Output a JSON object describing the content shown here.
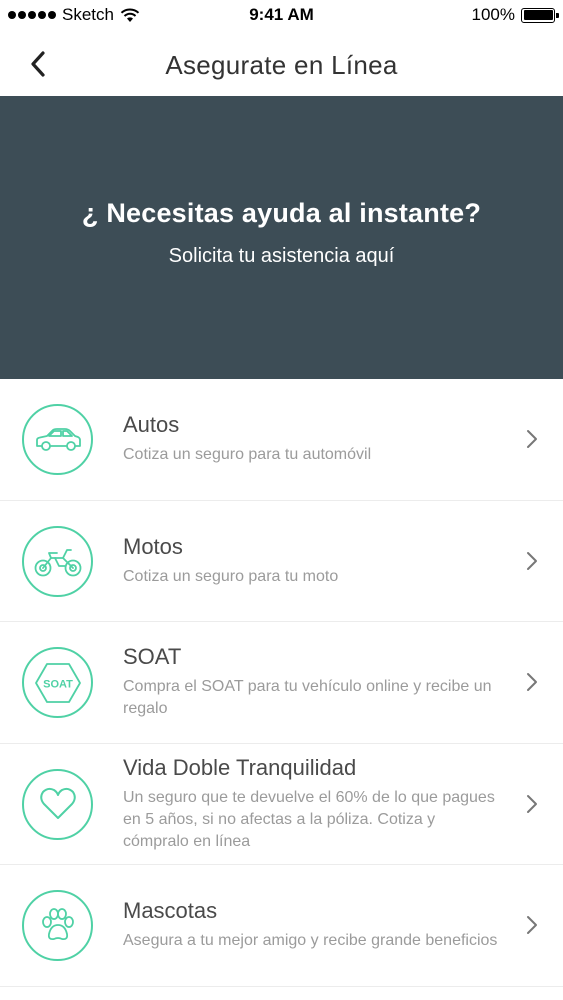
{
  "status_bar": {
    "carrier": "Sketch",
    "time": "9:41 AM",
    "battery": "100%"
  },
  "nav": {
    "title": "Asegurate en Línea",
    "back_icon": "chevron-left-icon"
  },
  "hero": {
    "title": "¿ Necesitas ayuda al instante?",
    "subtitle": "Solicita tu asistencia aquí",
    "background": "#3d4d56"
  },
  "colors": {
    "accent": "#4fd1a5",
    "title_text": "#4a4a4a",
    "desc_text": "#9b9b9b"
  },
  "items": [
    {
      "title": "Autos",
      "desc": "Cotiza un seguro para tu automóvil",
      "icon": "car-icon"
    },
    {
      "title": "Motos",
      "desc": "Cotiza un seguro para tu moto",
      "icon": "motorcycle-icon"
    },
    {
      "title": "SOAT",
      "desc": "Compra el SOAT para tu vehículo online y recibe un regalo",
      "icon": "soat-badge-icon",
      "icon_text": "SOAT"
    },
    {
      "title": "Vida Doble Tranquilidad",
      "desc": "Un seguro que te devuelve el 60% de lo que pagues en 5 años, si no afectas a la póliza. Cotiza y cómpralo en línea",
      "icon": "heart-icon"
    },
    {
      "title": "Mascotas",
      "desc": "Asegura a tu mejor amigo y recibe grande beneficios",
      "icon": "paw-icon"
    }
  ]
}
